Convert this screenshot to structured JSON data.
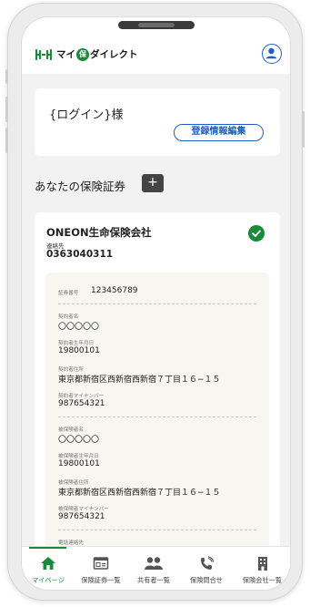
{
  "header": {
    "logo": {
      "text_before": "マイ",
      "badge": "保",
      "text_after": "ダイレクト"
    }
  },
  "login": {
    "greeting": "{ログイン}様",
    "edit_button": "登録情報編集"
  },
  "section": {
    "title": "あなたの保険証券",
    "add_button": "+"
  },
  "policy": {
    "company": "ONEON生命保険会社",
    "contact_label": "連絡先",
    "contact_number": "0363040311",
    "status_icon": "check-circle-icon",
    "fields": {
      "policy_number_label": "証券番号",
      "policy_number": "123456789",
      "holder_name_label": "契約者名",
      "holder_name": "〇〇〇〇〇",
      "holder_birth_label": "契約者生年月日",
      "holder_birth": "19800101",
      "holder_address_label": "契約者住所",
      "holder_address": "東京都新宿区西新宿西新宿７丁目１６−１５",
      "holder_mynumber_label": "契約者マイナンバー",
      "holder_mynumber": "987654321",
      "insured_name_label": "被保険者名",
      "insured_name": "〇〇〇〇〇",
      "insured_birth_label": "被保険者生年月日",
      "insured_birth": "19800101",
      "insured_address_label": "被保険者住所",
      "insured_address": "東京都新宿区西新宿西新宿７丁目１６−１５",
      "insured_mynumber_label": "被保険者マイナンバー",
      "insured_mynumber": "987654321",
      "phone_label": "電話連絡先"
    }
  },
  "tabs": [
    {
      "label": "マイページ",
      "icon": "home-icon",
      "active": true
    },
    {
      "label": "保険証券一覧",
      "icon": "policy-list-icon",
      "active": false
    },
    {
      "label": "共有者一覧",
      "icon": "people-icon",
      "active": false
    },
    {
      "label": "保険問合せ",
      "icon": "phone-icon",
      "active": false
    },
    {
      "label": "保険会社一覧",
      "icon": "building-icon",
      "active": false
    }
  ],
  "colors": {
    "accent_green": "#1a8a3a",
    "accent_blue": "#1b5fc4"
  }
}
